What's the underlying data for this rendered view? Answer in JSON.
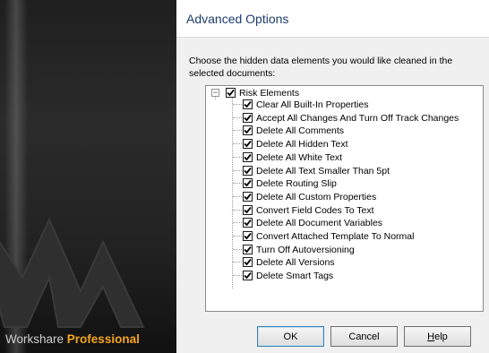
{
  "brand": {
    "name_plain": "Workshare",
    "name_strong": "Professional",
    "logo_icon": "workshare-w-logo-icon"
  },
  "dialog": {
    "title": "Advanced Options",
    "instructions": "Choose the hidden data elements you would like cleaned in the selected documents:"
  },
  "tree": {
    "root": {
      "label": "Risk Elements",
      "checked": true,
      "expanded": true,
      "expander_glyph": "−"
    },
    "items": [
      {
        "label": "Clear All Built-In Properties",
        "checked": true
      },
      {
        "label": "Accept All Changes And Turn Off Track Changes",
        "checked": true
      },
      {
        "label": "Delete All Comments",
        "checked": true
      },
      {
        "label": "Delete All Hidden Text",
        "checked": true
      },
      {
        "label": "Delete All White Text",
        "checked": true
      },
      {
        "label": "Delete All Text Smaller Than 5pt",
        "checked": true
      },
      {
        "label": "Delete Routing Slip",
        "checked": true
      },
      {
        "label": "Delete All Custom Properties",
        "checked": true
      },
      {
        "label": "Convert Field Codes To Text",
        "checked": true
      },
      {
        "label": "Delete All Document Variables",
        "checked": true
      },
      {
        "label": "Convert Attached Template To Normal",
        "checked": true
      },
      {
        "label": "Turn Off Autoversioning",
        "checked": true
      },
      {
        "label": "Delete All Versions",
        "checked": true
      },
      {
        "label": "Delete Smart Tags",
        "checked": true
      }
    ]
  },
  "buttons": {
    "ok": "OK",
    "cancel": "Cancel",
    "help": "Help",
    "help_mnemonic": "H",
    "help_rest": "elp"
  },
  "colors": {
    "brand_accent": "#f5a623",
    "title": "#1e3d6b",
    "dialog_bg": "#f0f0f0"
  }
}
